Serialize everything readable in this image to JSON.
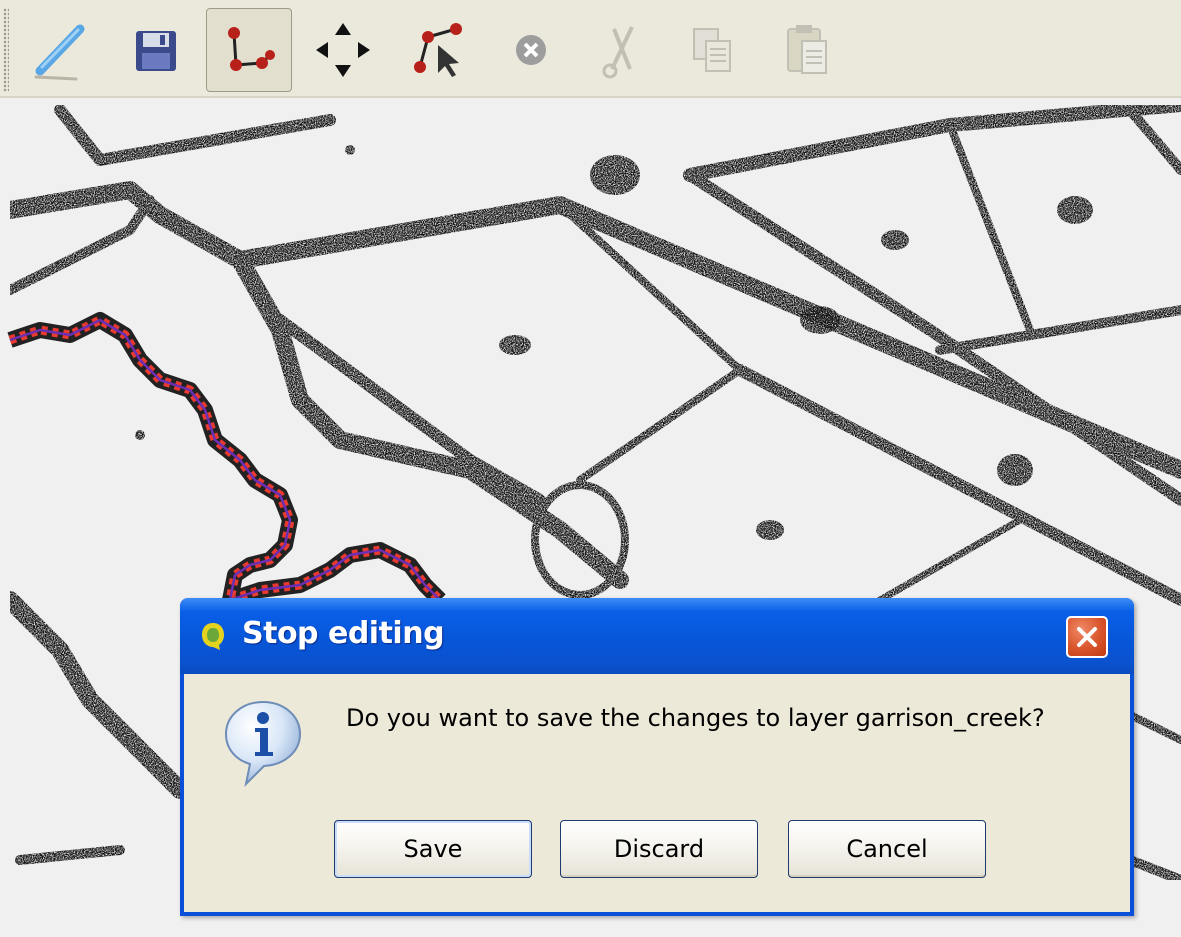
{
  "toolbar": {
    "items": [
      {
        "icon": "pencil-toggle-editing-icon",
        "active": false,
        "enabled": true
      },
      {
        "icon": "save-edits-icon",
        "active": false,
        "enabled": true
      },
      {
        "icon": "node-tool-icon",
        "active": true,
        "enabled": true
      },
      {
        "icon": "move-feature-icon",
        "active": false,
        "enabled": true
      },
      {
        "icon": "select-vertex-icon",
        "active": false,
        "enabled": true
      },
      {
        "icon": "delete-selected-icon",
        "active": false,
        "enabled": false
      },
      {
        "icon": "cut-features-icon",
        "active": false,
        "enabled": false
      },
      {
        "icon": "copy-features-icon",
        "active": false,
        "enabled": false
      },
      {
        "icon": "paste-features-icon",
        "active": false,
        "enabled": false
      }
    ]
  },
  "map": {
    "edited_layer_color": "#e83a2e",
    "edited_line_color": "#6a2fb4"
  },
  "dialog": {
    "title": "Stop editing",
    "message": "Do you want to save the changes to layer garrison_creek?",
    "buttons": {
      "save": "Save",
      "discard": "Discard",
      "cancel": "Cancel"
    },
    "icon": "information-icon",
    "close_icon": "close-icon",
    "titlebar_color": "#0756d8",
    "close_color": "#d9542a"
  }
}
